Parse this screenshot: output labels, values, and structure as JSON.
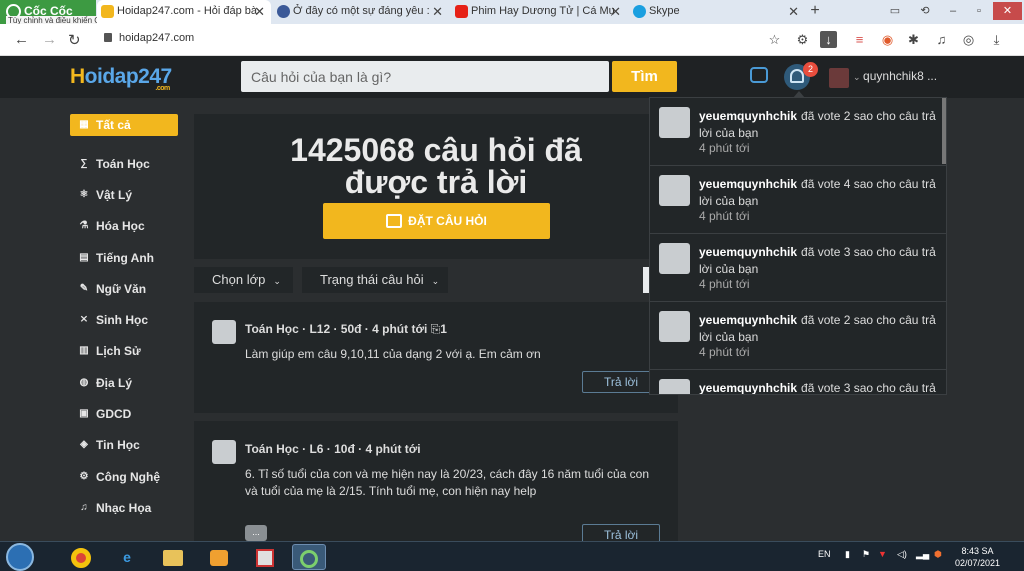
{
  "browser": {
    "brand": "Cốc Cốc",
    "tooltip": "Tùy chỉnh và điều khiển Cốc Cốc",
    "tabs": [
      {
        "title": "Hoidap247.com - Hỏi đáp bà",
        "active": true,
        "favicon": "hoidap-favicon"
      },
      {
        "title": "Ở đây có một sự đáng yêu :",
        "active": false,
        "favicon": "facebook-icon"
      },
      {
        "title": "Phim Hay Dương Tử | Cá Mụ",
        "active": false,
        "favicon": "youtube-icon"
      },
      {
        "title": "Skype",
        "active": false,
        "favicon": "skype-icon"
      }
    ],
    "url": "hoidap247.com"
  },
  "header": {
    "logo_main": "oidap247",
    "logo_h": "H",
    "logo_sub": ".com",
    "search_placeholder": "Câu hỏi của bạn là gì?",
    "search_button": "Tìm",
    "notification_count": "2",
    "username": "quynhchik8 ..."
  },
  "sidebar": {
    "items": [
      {
        "label": "Tất cả",
        "icon": "grid-icon"
      },
      {
        "label": "Toán Học",
        "icon": "math-icon"
      },
      {
        "label": "Vật Lý",
        "icon": "atom-icon"
      },
      {
        "label": "Hóa Học",
        "icon": "flask-icon"
      },
      {
        "label": "Tiếng Anh",
        "icon": "language-icon"
      },
      {
        "label": "Ngữ Văn",
        "icon": "pen-icon"
      },
      {
        "label": "Sinh Học",
        "icon": "dna-icon"
      },
      {
        "label": "Lịch Sử",
        "icon": "scroll-icon"
      },
      {
        "label": "Địa Lý",
        "icon": "globe-icon"
      },
      {
        "label": "GDCD",
        "icon": "book-icon"
      },
      {
        "label": "Tin Học",
        "icon": "code-icon"
      },
      {
        "label": "Công Nghệ",
        "icon": "gear-icon"
      },
      {
        "label": "Nhạc Họa",
        "icon": "music-icon"
      }
    ]
  },
  "hero": {
    "title_line1": "1425068 câu hỏi đã",
    "title_line2": "được trả lời",
    "ask_button": "ĐẶT CÂU HỎI"
  },
  "filters": {
    "grade": "Chọn lớp",
    "status": "Trạng thái câu hỏi"
  },
  "questions": [
    {
      "meta": "Toán Học · L12 · 50đ · 4 phút tới",
      "attach": "1",
      "text": "Làm giúp em câu 9,10,11 của dạng 2 với ạ. Em cảm ơn",
      "reply": "Trả lời"
    },
    {
      "meta": "Toán Học · L6 · 10đ · 4 phút tới",
      "text": "6. Tỉ số tuổi của con và mẹ hiện nay là 20/23, cách đây 16 năm tuổi của con và tuổi của mẹ là 2/15. Tính tuổi mẹ, con hiện nay help",
      "reply": "Trả lời",
      "emoji": "..."
    }
  ],
  "notifications": [
    {
      "user": "yeuemquynhchik",
      "action": "đã vote 2 sao cho câu trả lời của bạn",
      "time": "4 phút tới"
    },
    {
      "user": "yeuemquynhchik",
      "action": "đã vote 4 sao cho câu trả lời của bạn",
      "time": "4 phút tới"
    },
    {
      "user": "yeuemquynhchik",
      "action": "đã vote 3 sao cho câu trả lời của bạn",
      "time": "4 phút tới"
    },
    {
      "user": "yeuemquynhchik",
      "action": "đã vote 2 sao cho câu trả lời của bạn",
      "time": "4 phút tới"
    },
    {
      "user": "yeuemquynhchik",
      "action": "đã vote 3 sao cho câu trả",
      "time": ""
    }
  ],
  "taskbar": {
    "lang": "EN",
    "time": "8:43 SA",
    "date": "02/07/2021"
  },
  "colors": {
    "accent": "#f2b71e",
    "link": "#5aa7e8",
    "background": "#2b2e30"
  }
}
